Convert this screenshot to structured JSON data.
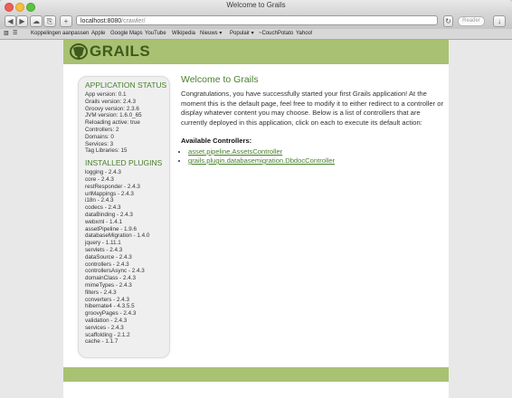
{
  "window": {
    "title": "Welcome to Grails"
  },
  "toolbar": {
    "url_host": "localhost:8080",
    "url_path": "/crawler/",
    "reader_label": "Reader",
    "add_label": "+"
  },
  "bookmarks": [
    "Koppelingen aanpassen",
    "Apple",
    "Google Maps",
    "YouTube",
    "Wikipedia",
    "Nieuws ▾",
    "Populair ▾",
    "~CouchPotato",
    "Yahoo!"
  ],
  "brand": {
    "logo_text": "GRAILS",
    "accent": "#48802c",
    "header_color": "#a9c172"
  },
  "sidebar": {
    "status_heading": "APPLICATION STATUS",
    "status_items": [
      "App version: 0.1",
      "Grails version: 2.4.3",
      "Groovy version: 2.3.6",
      "JVM version: 1.6.0_65",
      "Reloading active: true",
      "Controllers: 2",
      "Domains: 0",
      "Services: 3",
      "Tag Libraries: 15"
    ],
    "plugins_heading": "INSTALLED PLUGINS",
    "plugins": [
      "logging - 2.4.3",
      "core - 2.4.3",
      "restResponder - 2.4.3",
      "urlMappings - 2.4.3",
      "i18n - 2.4.3",
      "codecs - 2.4.3",
      "dataBinding - 2.4.3",
      "webxml - 1.4.1",
      "assetPipeline - 1.9.6",
      "databaseMigration - 1.4.0",
      "jquery - 1.11.1",
      "servlets - 2.4.3",
      "dataSource - 2.4.3",
      "controllers - 2.4.3",
      "controllersAsync - 2.4.3",
      "domainClass - 2.4.3",
      "mimeTypes - 2.4.3",
      "filters - 2.4.3",
      "converters - 2.4.3",
      "hibernate4 - 4.3.5.5",
      "groovyPages - 2.4.3",
      "validation - 2.4.3",
      "services - 2.4.3",
      "scaffolding - 2.1.2",
      "cache - 1.1.7"
    ]
  },
  "main": {
    "heading": "Welcome to Grails",
    "intro": "Congratulations, you have successfully started your first Grails application! At the moment this is the default page, feel free to modify it to either redirect to a controller or display whatever content you may choose. Below is a list of controllers that are currently deployed in this application, click on each to execute its default action:",
    "controllers_heading": "Available Controllers:",
    "controllers": [
      "asset.pipeline.AssetsController",
      "grails.plugin.databasemigration.DbdocController"
    ]
  }
}
